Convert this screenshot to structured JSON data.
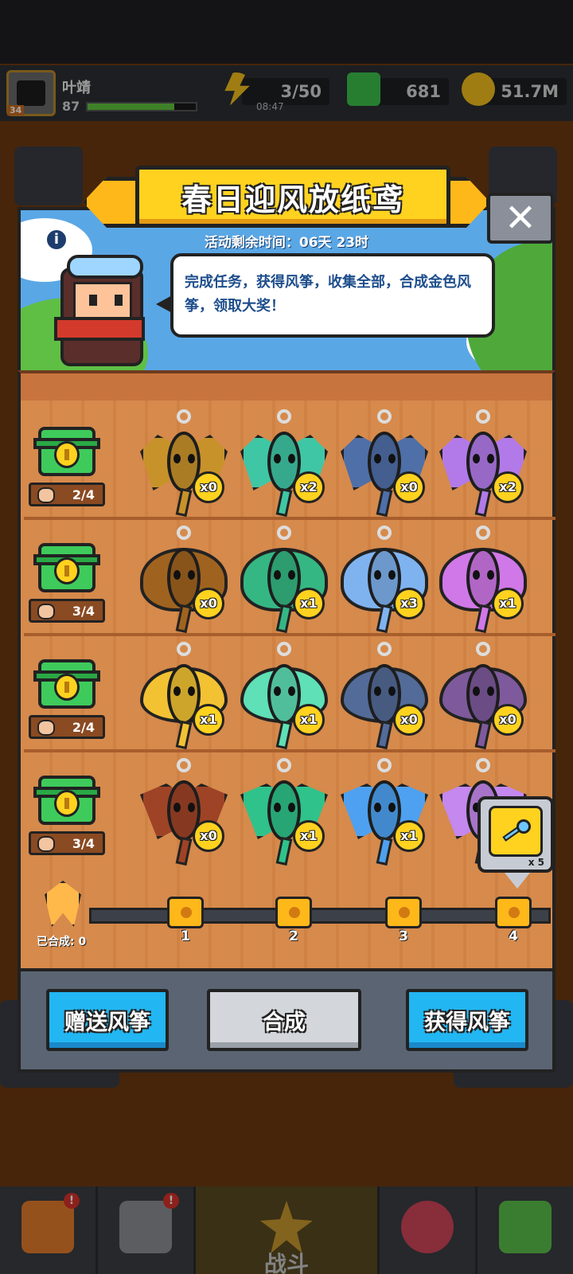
{
  "hud": {
    "player_name": "叶靖",
    "player_level": "87",
    "avatar_level": "34",
    "xp_fill": 0.8,
    "energy": "3/50",
    "energy_timer": "08:47",
    "gems": "681",
    "coins": "51.7M"
  },
  "colors": {
    "title_banner": "#ffd21f",
    "sky": "#5aa7e6",
    "board": "#d68a4c",
    "chest": "#3ecb5b",
    "blue_button": "#22b6f2",
    "gray_button": "#d3d6db"
  },
  "modal": {
    "title": "春日迎风放纸鸢",
    "timer": "活动剩余时间：06天 23时",
    "speech": "完成任务，获得风筝，收集全部，合成金色风筝，领取大奖！",
    "info_icon": "i",
    "close_icon": "✕",
    "rows": [
      {
        "progress": "2/4",
        "shape": "bat",
        "kites": [
          {
            "color": "#c8922a",
            "count": "x0"
          },
          {
            "color": "#3fc7a5",
            "count": "x2"
          },
          {
            "color": "#4f6fa8",
            "count": "x0"
          },
          {
            "color": "#b27ae8",
            "count": "x2"
          }
        ]
      },
      {
        "progress": "3/4",
        "shape": "beetle",
        "kites": [
          {
            "color": "#a0631f",
            "count": "x0"
          },
          {
            "color": "#35b783",
            "count": "x1"
          },
          {
            "color": "#7fb3f0",
            "count": "x3"
          },
          {
            "color": "#d078e8",
            "count": "x1"
          }
        ]
      },
      {
        "progress": "2/4",
        "shape": "butterfly",
        "kites": [
          {
            "color": "#f2c233",
            "count": "x1"
          },
          {
            "color": "#5fe0b6",
            "count": "x1"
          },
          {
            "color": "#536b98",
            "count": "x0"
          },
          {
            "color": "#7e5a9c",
            "count": "x0"
          }
        ]
      },
      {
        "progress": "3/4",
        "shape": "bird",
        "kites": [
          {
            "color": "#9e4326",
            "count": "x0"
          },
          {
            "color": "#2fc28a",
            "count": "x1"
          },
          {
            "color": "#4da1f0",
            "count": "x1"
          },
          {
            "color": "#c488ee",
            "count": ""
          }
        ]
      }
    ],
    "key_popup_qty": "x 5",
    "milestones": [
      "1",
      "2",
      "3",
      "4"
    ],
    "composed_label": "已合成: 0",
    "buttons": {
      "gift": "赠送风筝",
      "combine": "合成",
      "obtain": "获得风筝"
    }
  },
  "bottom_nav": {
    "active_label": "战斗",
    "badge": "!"
  }
}
